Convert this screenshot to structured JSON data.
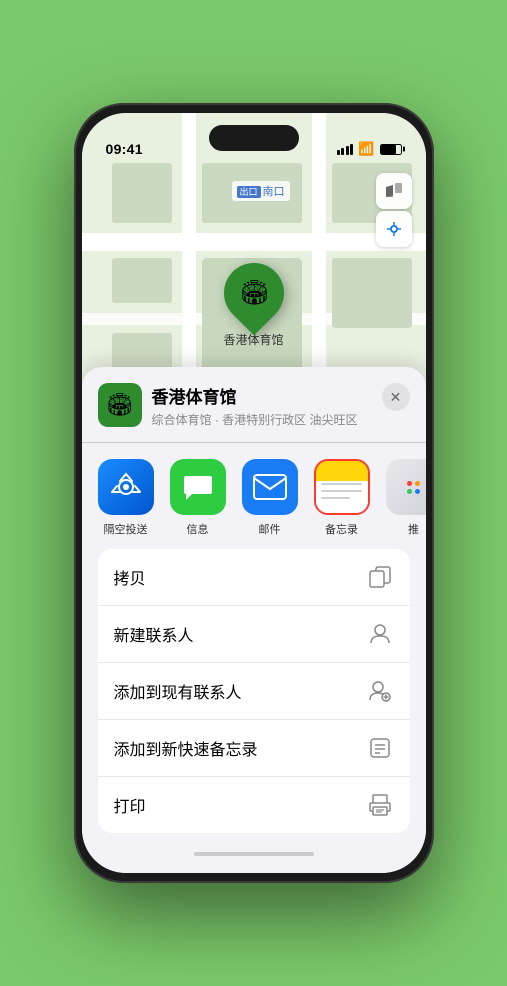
{
  "device": {
    "time": "09:41",
    "location_arrow": "▲"
  },
  "map": {
    "label_text": "南口",
    "label_prefix": "出口",
    "controls": {
      "map_icon": "🗺",
      "compass_icon": "◎"
    }
  },
  "pin": {
    "label": "香港体育馆",
    "emoji": "🏟"
  },
  "bottom_sheet": {
    "venue_name": "香港体育馆",
    "venue_subtitle": "综合体育馆 · 香港特别行政区 油尖旺区",
    "close_label": "✕"
  },
  "share_apps": [
    {
      "label": "隔空投送",
      "type": "airdrop"
    },
    {
      "label": "信息",
      "type": "messages"
    },
    {
      "label": "邮件",
      "type": "mail"
    },
    {
      "label": "备忘录",
      "type": "notes",
      "highlighted": true
    },
    {
      "label": "推",
      "type": "more"
    }
  ],
  "actions": [
    {
      "label": "拷贝",
      "icon": "copy"
    },
    {
      "label": "新建联系人",
      "icon": "person-add"
    },
    {
      "label": "添加到现有联系人",
      "icon": "person-plus"
    },
    {
      "label": "添加到新快速备忘录",
      "icon": "note"
    },
    {
      "label": "打印",
      "icon": "print"
    }
  ]
}
